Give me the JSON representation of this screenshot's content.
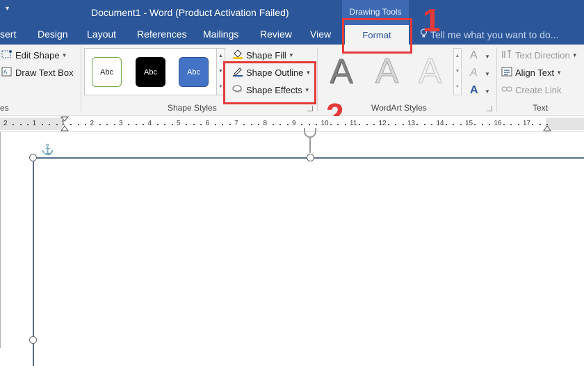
{
  "titlebar": {
    "quick_access": "▾",
    "title": "Document1 - Word (Product Activation Failed)",
    "context_header": "Drawing Tools"
  },
  "tabs": [
    {
      "label": "sert"
    },
    {
      "label": "Design"
    },
    {
      "label": "Layout"
    },
    {
      "label": "References"
    },
    {
      "label": "Mailings"
    },
    {
      "label": "Review"
    },
    {
      "label": "View"
    },
    {
      "label": "Format"
    }
  ],
  "tell_me": "Tell me what you want to do...",
  "ribbon": {
    "insert_shapes": {
      "edit_shape": "Edit Shape",
      "draw_text_box": "Draw Text Box",
      "group_label_tail": "es"
    },
    "shape_styles": {
      "swatches": [
        "Abc",
        "Abc",
        "Abc"
      ],
      "shape_fill": "Shape Fill",
      "shape_outline": "Shape Outline",
      "shape_effects": "Shape Effects",
      "group_label": "Shape Styles"
    },
    "wordart_styles": {
      "letters": [
        "A",
        "A",
        "A"
      ],
      "small_letters": [
        "A",
        "A",
        "A"
      ],
      "group_label": "WordArt Styles"
    },
    "text": {
      "text_direction": "Text Direction",
      "align_text": "Align Text",
      "create_link": "Create Link",
      "group_label": "Text"
    }
  },
  "annotations": {
    "step1": "1",
    "step2": "2"
  },
  "ruler": {
    "numbers": [
      "2",
      "1",
      "1",
      "2",
      "3",
      "4",
      "5",
      "6",
      "7",
      "8",
      "9",
      "10",
      "11",
      "12",
      "13",
      "14",
      "15",
      "16",
      "17"
    ]
  },
  "colors": {
    "word_blue": "#2b579a",
    "highlight_red": "#e53a3a",
    "swatch_black": "#000000",
    "swatch_blue": "#4472c4",
    "swatch_outline_green": "#70ad47"
  }
}
